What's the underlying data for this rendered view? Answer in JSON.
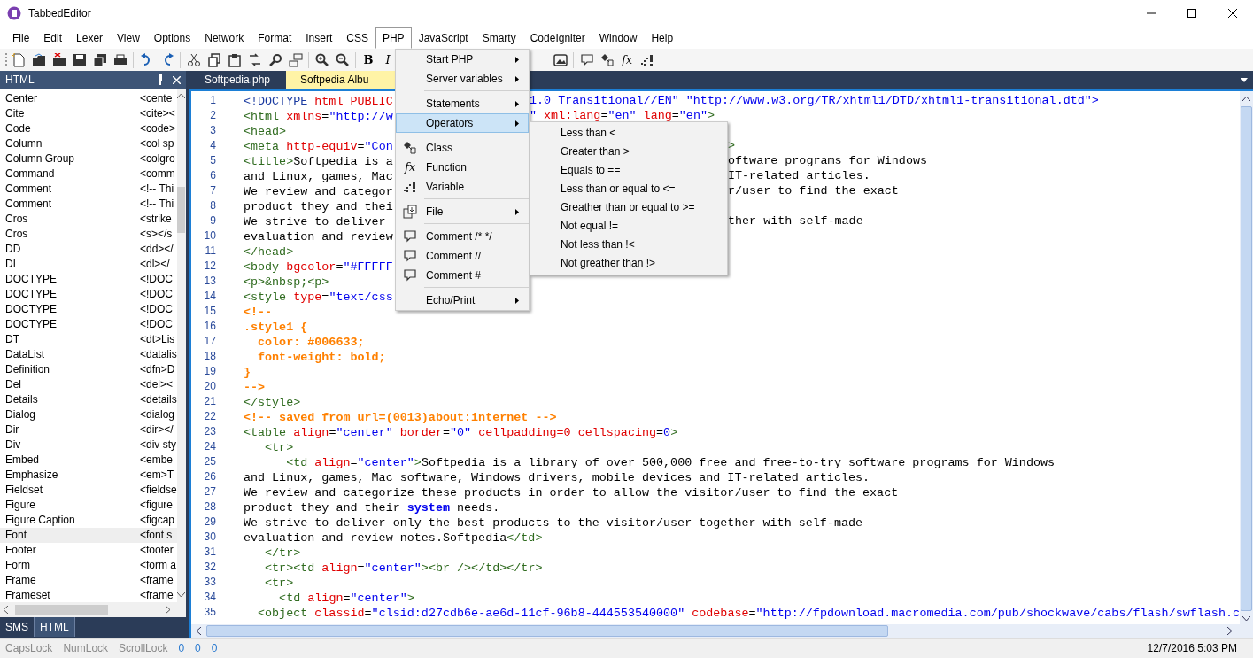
{
  "window": {
    "title": "TabbedEditor"
  },
  "menu_bar": [
    {
      "label": "File",
      "selected": false
    },
    {
      "label": "Edit",
      "selected": false
    },
    {
      "label": "Lexer",
      "selected": false
    },
    {
      "label": "View",
      "selected": false
    },
    {
      "label": "Options",
      "selected": false
    },
    {
      "label": "Network",
      "selected": false
    },
    {
      "label": "Format",
      "selected": false
    },
    {
      "label": "Insert",
      "selected": false
    },
    {
      "label": "CSS",
      "selected": false
    },
    {
      "label": "PHP",
      "selected": true
    },
    {
      "label": "JavaScript",
      "selected": false
    },
    {
      "label": "Smarty",
      "selected": false
    },
    {
      "label": "CodeIgniter",
      "selected": false
    },
    {
      "label": "Window",
      "selected": false
    },
    {
      "label": "Help",
      "selected": false
    }
  ],
  "toolbar": {
    "text_buttons": [
      "B",
      "I"
    ],
    "function_button": "fx"
  },
  "side_panel": {
    "title": "HTML",
    "items": [
      {
        "name": "Center",
        "snippet": "<cente",
        "selected": false
      },
      {
        "name": "Cite",
        "snippet": "<cite><",
        "selected": false
      },
      {
        "name": "Code",
        "snippet": "<code>",
        "selected": false
      },
      {
        "name": "Column",
        "snippet": "<col sp",
        "selected": false
      },
      {
        "name": "Column Group",
        "snippet": "<colgro",
        "selected": false
      },
      {
        "name": "Command",
        "snippet": "<comm",
        "selected": false
      },
      {
        "name": "Comment",
        "snippet": "<!-- Thi",
        "selected": false
      },
      {
        "name": "Comment",
        "snippet": "<!-- Thi",
        "selected": false
      },
      {
        "name": "Cros",
        "snippet": "<strike",
        "selected": false
      },
      {
        "name": "Cros",
        "snippet": "<s></s",
        "selected": false
      },
      {
        "name": "DD",
        "snippet": "<dd></",
        "selected": false
      },
      {
        "name": "DL",
        "snippet": "<dl></",
        "selected": false
      },
      {
        "name": "DOCTYPE",
        "snippet": "<!DOC",
        "selected": false
      },
      {
        "name": "DOCTYPE",
        "snippet": "<!DOC",
        "selected": false
      },
      {
        "name": "DOCTYPE",
        "snippet": "<!DOC",
        "selected": false
      },
      {
        "name": "DOCTYPE",
        "snippet": "<!DOC",
        "selected": false
      },
      {
        "name": "DT",
        "snippet": "<dt>Lis",
        "selected": false
      },
      {
        "name": "DataList",
        "snippet": "<datalis",
        "selected": false
      },
      {
        "name": "Definition",
        "snippet": "<dfn>D",
        "selected": false
      },
      {
        "name": "Del",
        "snippet": "<del><",
        "selected": false
      },
      {
        "name": "Details",
        "snippet": "<details",
        "selected": false
      },
      {
        "name": "Dialog",
        "snippet": "<dialog",
        "selected": false
      },
      {
        "name": "Dir",
        "snippet": "<dir></",
        "selected": false
      },
      {
        "name": "Div",
        "snippet": "<div sty",
        "selected": false
      },
      {
        "name": "Embed",
        "snippet": "<embe",
        "selected": false
      },
      {
        "name": "Emphasize",
        "snippet": "<em>T",
        "selected": false
      },
      {
        "name": "Fieldset",
        "snippet": "<fieldse",
        "selected": false
      },
      {
        "name": "Figure",
        "snippet": "<figure",
        "selected": false
      },
      {
        "name": "Figure Caption",
        "snippet": "<figcap",
        "selected": false
      },
      {
        "name": "Font",
        "snippet": "<font s",
        "selected": true
      },
      {
        "name": "Footer",
        "snippet": "<footer",
        "selected": false
      },
      {
        "name": "Form",
        "snippet": "<form a",
        "selected": false
      },
      {
        "name": "Frame",
        "snippet": "<frame",
        "selected": false
      },
      {
        "name": "Frameset",
        "snippet": "<frame",
        "selected": false
      }
    ],
    "bottom_tabs": [
      {
        "label": "SMS",
        "selected": false
      },
      {
        "label": "HTML",
        "selected": true
      }
    ]
  },
  "document_tabs": [
    {
      "label": "Softpedia.php",
      "selected": false
    },
    {
      "label": "Softpedia Albu",
      "selected": true
    }
  ],
  "code_lines": [
    {
      "num": "1",
      "parts": [
        {
          "kind": "doctype",
          "text": "<!DOCTYPE"
        },
        {
          "kind": "attr",
          "text": " html PUBLIC"
        }
      ],
      "after": [
        {
          "kind": "value",
          "text": "1.0 Transitional//EN\" \"http://www.w3.org/TR/xhtml1/DTD/xhtml1-transitional.dtd\">"
        }
      ]
    },
    {
      "num": "2",
      "parts": [
        {
          "kind": "tag",
          "text": "<html"
        },
        {
          "kind": "attr",
          "text": " xmlns"
        },
        {
          "kind": "text",
          "text": "="
        },
        {
          "kind": "value",
          "text": "\"http://w"
        }
      ],
      "after": [
        {
          "kind": "value",
          "text": "\""
        },
        {
          "kind": "attr",
          "text": " xml:lang"
        },
        {
          "kind": "text",
          "text": "="
        },
        {
          "kind": "value",
          "text": "\"en\""
        },
        {
          "kind": "attr",
          "text": " lang"
        },
        {
          "kind": "text",
          "text": "="
        },
        {
          "kind": "value",
          "text": "\"en\""
        },
        {
          "kind": "tag",
          "text": ">"
        }
      ]
    },
    {
      "num": "3",
      "parts": [
        {
          "kind": "tag",
          "text": "<head>"
        }
      ]
    },
    {
      "num": "4",
      "parts": [
        {
          "kind": "tag",
          "text": "<meta"
        },
        {
          "kind": "attr",
          "text": " http-equiv"
        },
        {
          "kind": "text",
          "text": "="
        },
        {
          "kind": "value",
          "text": "\"Con"
        }
      ],
      "after": [
        {
          "kind": "tag",
          "text": ">"
        }
      ]
    },
    {
      "num": "5",
      "parts": [
        {
          "kind": "tag",
          "text": "<title>"
        },
        {
          "kind": "text",
          "text": "Softpedia is a"
        }
      ],
      "after": [
        {
          "kind": "text",
          "text": "oftware programs for Windows"
        }
      ]
    },
    {
      "num": "6",
      "parts": [
        {
          "kind": "text",
          "text": "and Linux, games, Mac"
        }
      ],
      "after": [
        {
          "kind": "text",
          "text": "IT-related articles."
        }
      ]
    },
    {
      "num": "7",
      "parts": [
        {
          "kind": "text",
          "text": "We review and categor"
        }
      ],
      "after": [
        {
          "kind": "text",
          "text": "r/user to find the exact"
        }
      ]
    },
    {
      "num": "8",
      "parts": [
        {
          "kind": "text",
          "text": "product they and thei"
        }
      ]
    },
    {
      "num": "9",
      "parts": [
        {
          "kind": "text",
          "text": "We strive to deliver"
        }
      ],
      "after": [
        {
          "kind": "text",
          "text": "ther with self-made"
        }
      ]
    },
    {
      "num": "10",
      "parts": [
        {
          "kind": "text",
          "text": "evaluation and review"
        }
      ]
    },
    {
      "num": "11",
      "parts": [
        {
          "kind": "tag",
          "text": "</head>"
        }
      ]
    },
    {
      "num": "12",
      "parts": [
        {
          "kind": "tag",
          "text": "<body"
        },
        {
          "kind": "attr",
          "text": " bgcolor"
        },
        {
          "kind": "text",
          "text": "="
        },
        {
          "kind": "value",
          "text": "\"#FFFFF"
        }
      ]
    },
    {
      "num": "13",
      "parts": [
        {
          "kind": "tag",
          "text": "<p>&nbsp;<p>"
        }
      ]
    },
    {
      "num": "14",
      "parts": [
        {
          "kind": "tag",
          "text": "<style"
        },
        {
          "kind": "attr",
          "text": " type"
        },
        {
          "kind": "text",
          "text": "="
        },
        {
          "kind": "value",
          "text": "\"text/css"
        }
      ]
    },
    {
      "num": "15",
      "parts": [
        {
          "kind": "css",
          "text": "<!--"
        }
      ]
    },
    {
      "num": "16",
      "parts": [
        {
          "kind": "css",
          "text": ".style1 {"
        }
      ]
    },
    {
      "num": "17",
      "parts": [
        {
          "kind": "css",
          "text": "  color: #006633;"
        }
      ]
    },
    {
      "num": "18",
      "parts": [
        {
          "kind": "css",
          "text": "  font-weight: bold;"
        }
      ]
    },
    {
      "num": "19",
      "parts": [
        {
          "kind": "css",
          "text": "}"
        }
      ]
    },
    {
      "num": "20",
      "parts": [
        {
          "kind": "css",
          "text": "-->"
        }
      ]
    },
    {
      "num": "21",
      "parts": [
        {
          "kind": "tag",
          "text": "</style>"
        }
      ]
    },
    {
      "num": "22",
      "parts": [
        {
          "kind": "css",
          "text": "<!-- saved from url=(0013)about:internet -->"
        }
      ]
    },
    {
      "num": "23",
      "parts": [
        {
          "kind": "tag",
          "text": "<table"
        },
        {
          "kind": "attr",
          "text": " align"
        },
        {
          "kind": "text",
          "text": "="
        },
        {
          "kind": "value",
          "text": "\"center\""
        },
        {
          "kind": "attr",
          "text": " border"
        },
        {
          "kind": "text",
          "text": "="
        },
        {
          "kind": "value",
          "text": "\"0\""
        },
        {
          "kind": "attr",
          "text": " cellpadding=0"
        },
        {
          "kind": "attr",
          "text": " cellspacing"
        },
        {
          "kind": "text",
          "text": "="
        },
        {
          "kind": "value",
          "text": "0"
        },
        {
          "kind": "tag",
          "text": ">"
        }
      ]
    },
    {
      "num": "24",
      "parts": [
        {
          "kind": "tag",
          "text": "   <tr>"
        }
      ]
    },
    {
      "num": "25",
      "parts": [
        {
          "kind": "tag",
          "text": "      <td"
        },
        {
          "kind": "attr",
          "text": " align"
        },
        {
          "kind": "text",
          "text": "="
        },
        {
          "kind": "value",
          "text": "\"center\""
        },
        {
          "kind": "tag",
          "text": ">"
        },
        {
          "kind": "text",
          "text": "Softpedia is a library of over 500,000 free and free-to-try software programs for Windows"
        }
      ]
    },
    {
      "num": "26",
      "parts": [
        {
          "kind": "text",
          "text": "and Linux, games, Mac software, Windows drivers, mobile devices and IT-related articles."
        }
      ]
    },
    {
      "num": "27",
      "parts": [
        {
          "kind": "text",
          "text": "We review and categorize these products in order to allow the visitor/user to find the exact"
        }
      ]
    },
    {
      "num": "28",
      "parts": [
        {
          "kind": "text",
          "text": "product they and their "
        },
        {
          "kind": "keyword",
          "text": "system"
        },
        {
          "kind": "text",
          "text": " needs."
        }
      ]
    },
    {
      "num": "29",
      "parts": [
        {
          "kind": "text",
          "text": "We strive to deliver only the best products to the visitor/user together with self-made"
        }
      ]
    },
    {
      "num": "30",
      "parts": [
        {
          "kind": "text",
          "text": "evaluation and review notes.Softpedia"
        },
        {
          "kind": "tag",
          "text": "</td>"
        }
      ]
    },
    {
      "num": "31",
      "parts": [
        {
          "kind": "tag",
          "text": "   </tr>"
        }
      ]
    },
    {
      "num": "32",
      "parts": [
        {
          "kind": "tag",
          "text": "   <tr><td"
        },
        {
          "kind": "attr",
          "text": " align"
        },
        {
          "kind": "text",
          "text": "="
        },
        {
          "kind": "value",
          "text": "\"center\""
        },
        {
          "kind": "tag",
          "text": "><br /></td></tr>"
        }
      ]
    },
    {
      "num": "33",
      "parts": [
        {
          "kind": "tag",
          "text": "   <tr>"
        }
      ]
    },
    {
      "num": "34",
      "parts": [
        {
          "kind": "tag",
          "text": "     <td"
        },
        {
          "kind": "attr",
          "text": " align"
        },
        {
          "kind": "text",
          "text": "="
        },
        {
          "kind": "value",
          "text": "\"center\""
        },
        {
          "kind": "tag",
          "text": ">"
        }
      ]
    },
    {
      "num": "35",
      "parts": [
        {
          "kind": "tag",
          "text": "  <object"
        },
        {
          "kind": "attr",
          "text": " classid"
        },
        {
          "kind": "text",
          "text": "="
        },
        {
          "kind": "value",
          "text": "\"clsid:d27cdb6e-ae6d-11cf-96b8-444553540000\""
        },
        {
          "kind": "attr",
          "text": " codebase"
        },
        {
          "kind": "text",
          "text": "="
        },
        {
          "kind": "value",
          "text": "\"http://fpdownload.macromedia.com/pub/shockwave/cabs/flash/swflash.c"
        }
      ]
    }
  ],
  "php_menu": [
    {
      "kind": "plain",
      "label": "Start PHP",
      "has_submenu": true,
      "selected": false
    },
    {
      "kind": "plain",
      "label": "Server variables",
      "has_submenu": true,
      "selected": false
    },
    {
      "kind": "separator"
    },
    {
      "kind": "plain",
      "label": "Statements",
      "has_submenu": true,
      "selected": false
    },
    {
      "kind": "plain",
      "label": "Operators",
      "has_submenu": true,
      "selected": true
    },
    {
      "kind": "separator"
    },
    {
      "kind": "class",
      "label": "Class",
      "has_submenu": false,
      "selected": false
    },
    {
      "kind": "function",
      "label": "Function",
      "icon_text": "fx",
      "has_submenu": false,
      "selected": false
    },
    {
      "kind": "variable",
      "label": "Variable",
      "has_submenu": false,
      "selected": false
    },
    {
      "kind": "separator"
    },
    {
      "kind": "file",
      "label": "File",
      "has_submenu": true,
      "selected": false
    },
    {
      "kind": "separator"
    },
    {
      "kind": "comment",
      "label": "Comment /* */",
      "has_submenu": false,
      "selected": false
    },
    {
      "kind": "comment",
      "label": "Comment //",
      "has_submenu": false,
      "selected": false
    },
    {
      "kind": "comment",
      "label": "Comment #",
      "has_submenu": false,
      "selected": false
    },
    {
      "kind": "separator"
    },
    {
      "kind": "plain",
      "label": "Echo/Print",
      "has_submenu": true,
      "selected": false
    }
  ],
  "operators_submenu": [
    "Less than <",
    "Greater than >",
    "Equals to ==",
    "Less than or equal to <=",
    "Greather than or equal to >=",
    "Not equal !=",
    "Not less than !<",
    "Not greather than !>"
  ],
  "status_bar": {
    "locks": [
      {
        "label": "CapsLock",
        "on": false
      },
      {
        "label": "NumLock",
        "on": false
      },
      {
        "label": "ScrollLock",
        "on": false
      }
    ],
    "counters": [
      "0",
      "0",
      "0"
    ],
    "datetime": "12/7/2016 5:03 PM"
  }
}
